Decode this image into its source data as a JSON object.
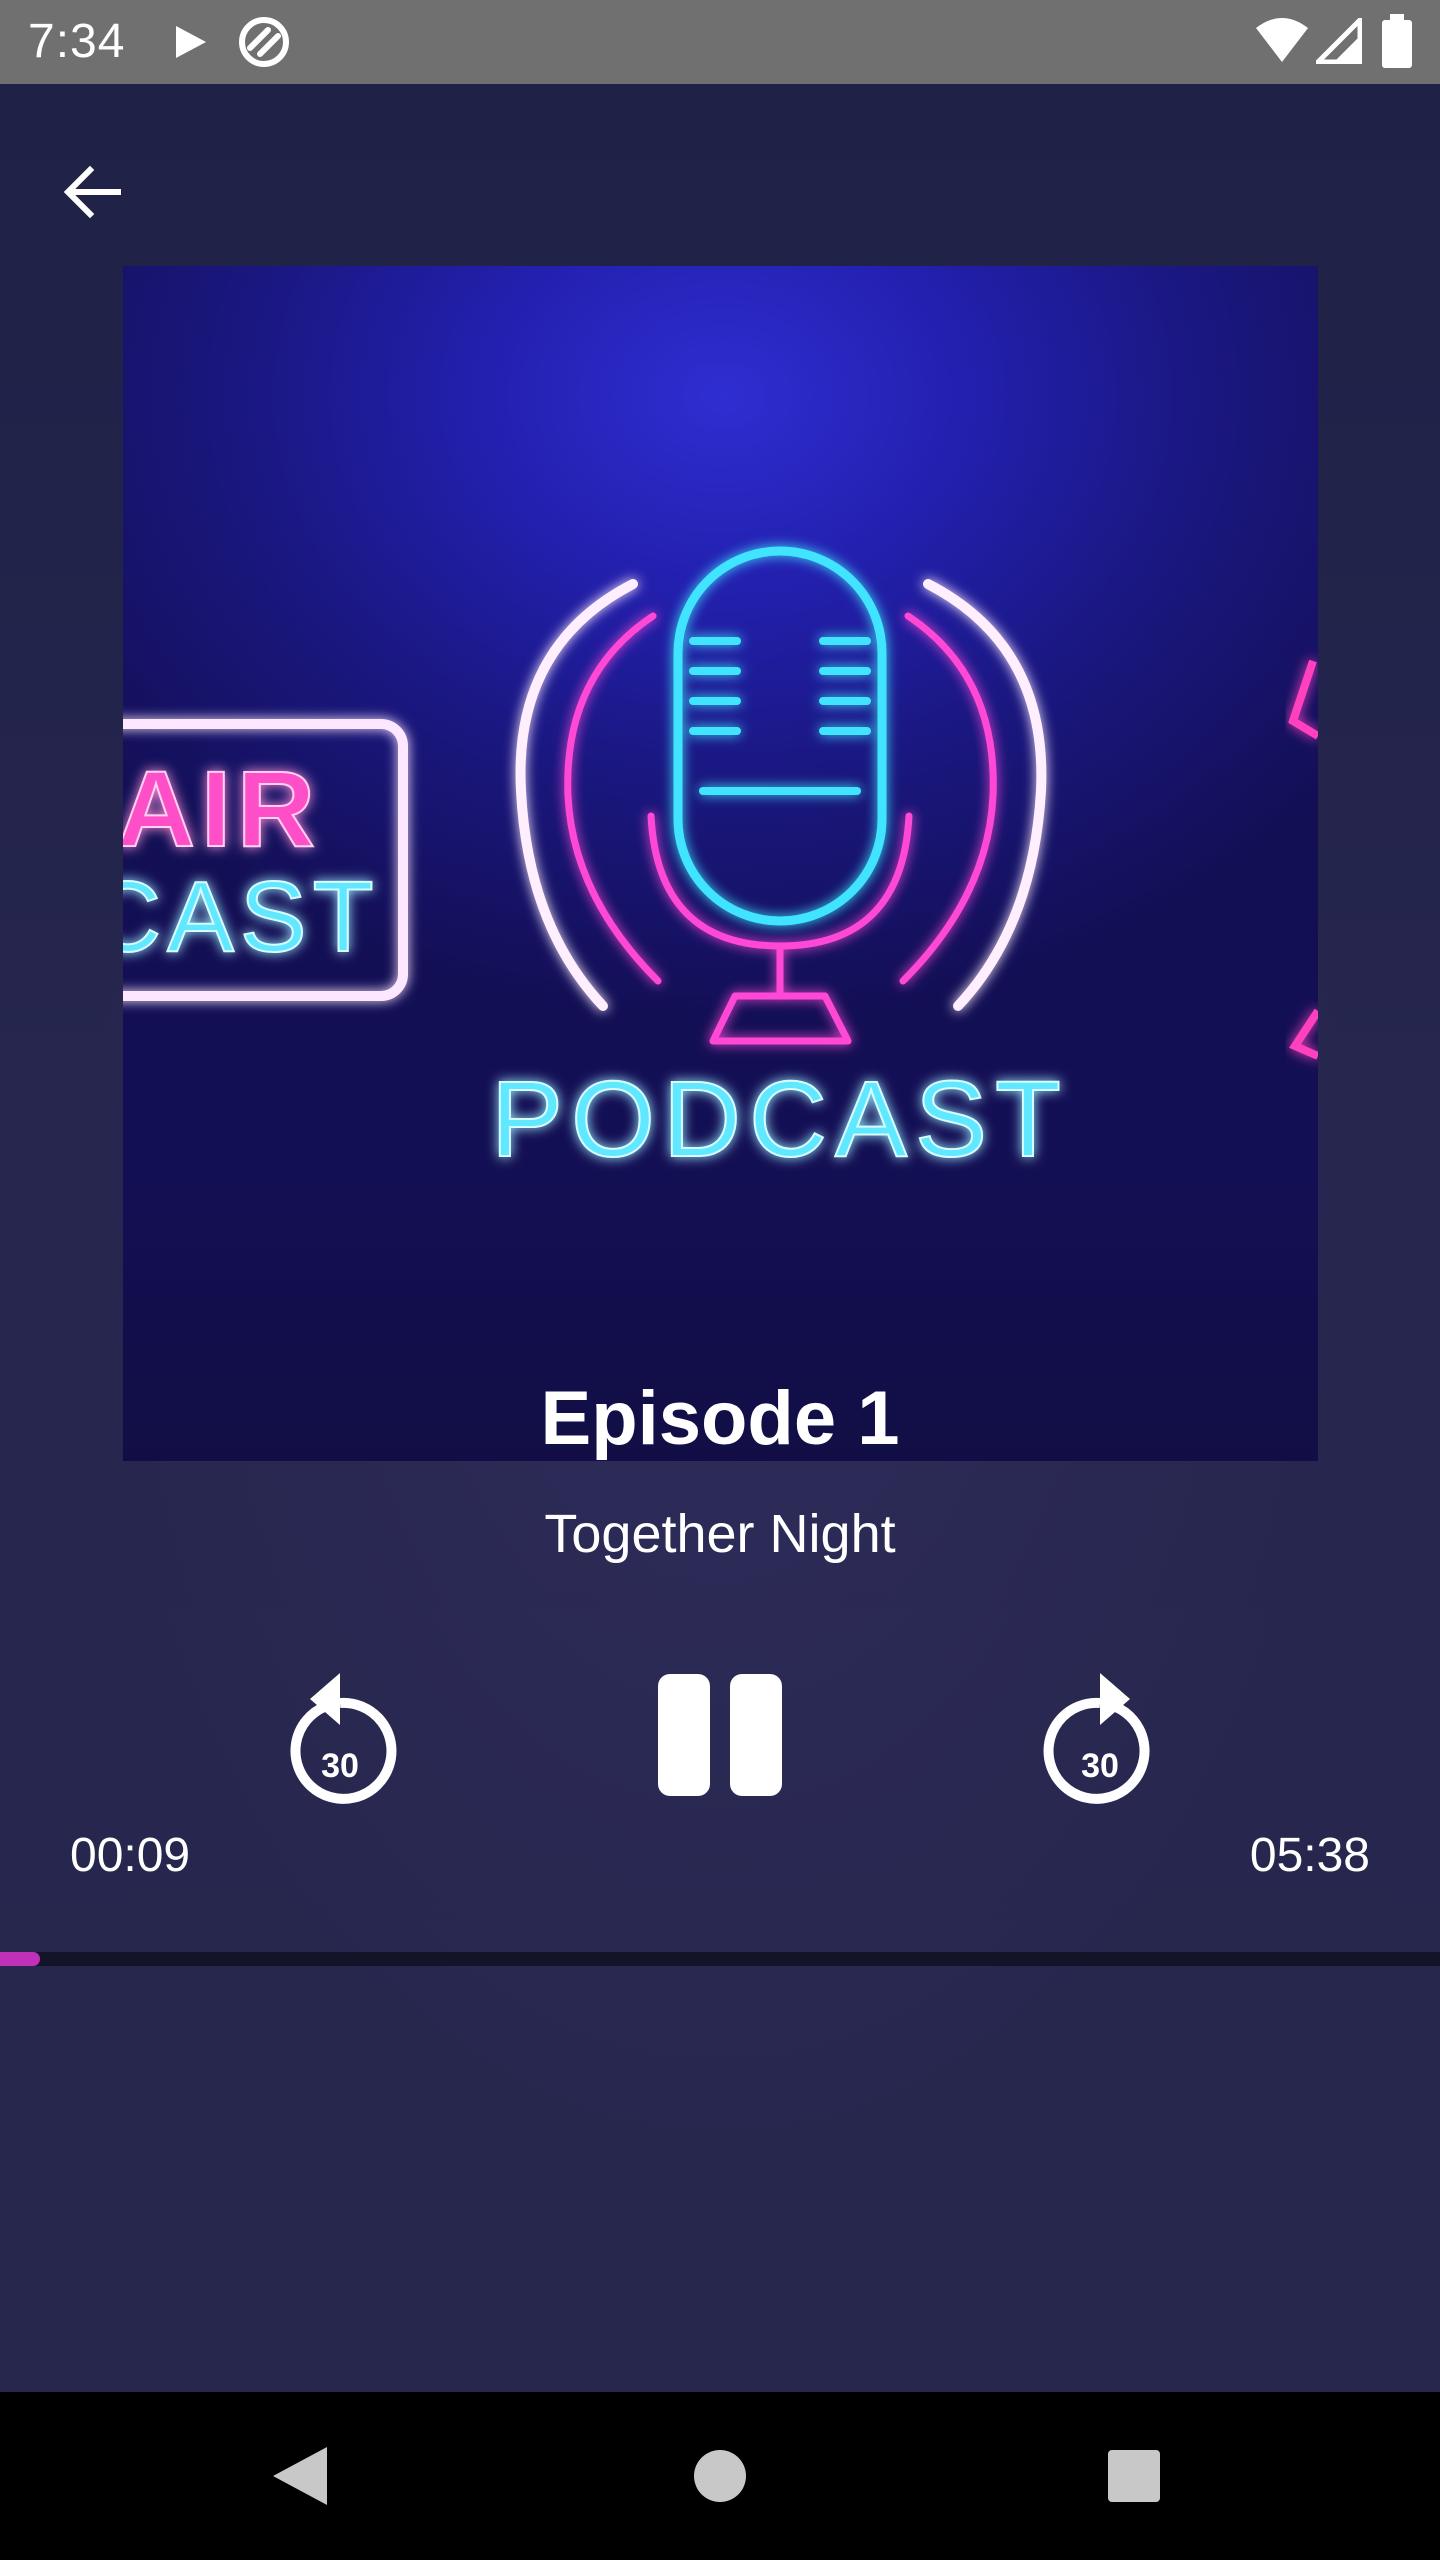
{
  "status_bar": {
    "time": "7:34",
    "icons": [
      "play-icon",
      "sync-icon",
      "wifi-icon",
      "signal-icon",
      "battery-icon"
    ]
  },
  "header": {
    "back_icon": "arrow-left-icon"
  },
  "artwork": {
    "text_main": "PODCAST",
    "text_left_line1": "AIR",
    "text_left_line2": "CAST"
  },
  "episode": {
    "title": "Episode 1",
    "subtitle": "Together Night"
  },
  "controls": {
    "rewind_label": "30",
    "forward_label": "30",
    "rewind_icon": "replay-30-icon",
    "pause_icon": "pause-icon",
    "forward_icon": "forward-30-icon"
  },
  "playback": {
    "current_time": "00:09",
    "total_time": "05:38",
    "progress_fraction": 0.0279
  },
  "colors": {
    "status_bar": "#707070",
    "background": "#26264f",
    "progress_fill": "#c030b8",
    "progress_track": "#141428",
    "nav_bar": "#000000"
  },
  "nav_bar": {
    "back_icon": "nav-back-icon",
    "home_icon": "nav-home-icon",
    "recents_icon": "nav-recents-icon"
  }
}
